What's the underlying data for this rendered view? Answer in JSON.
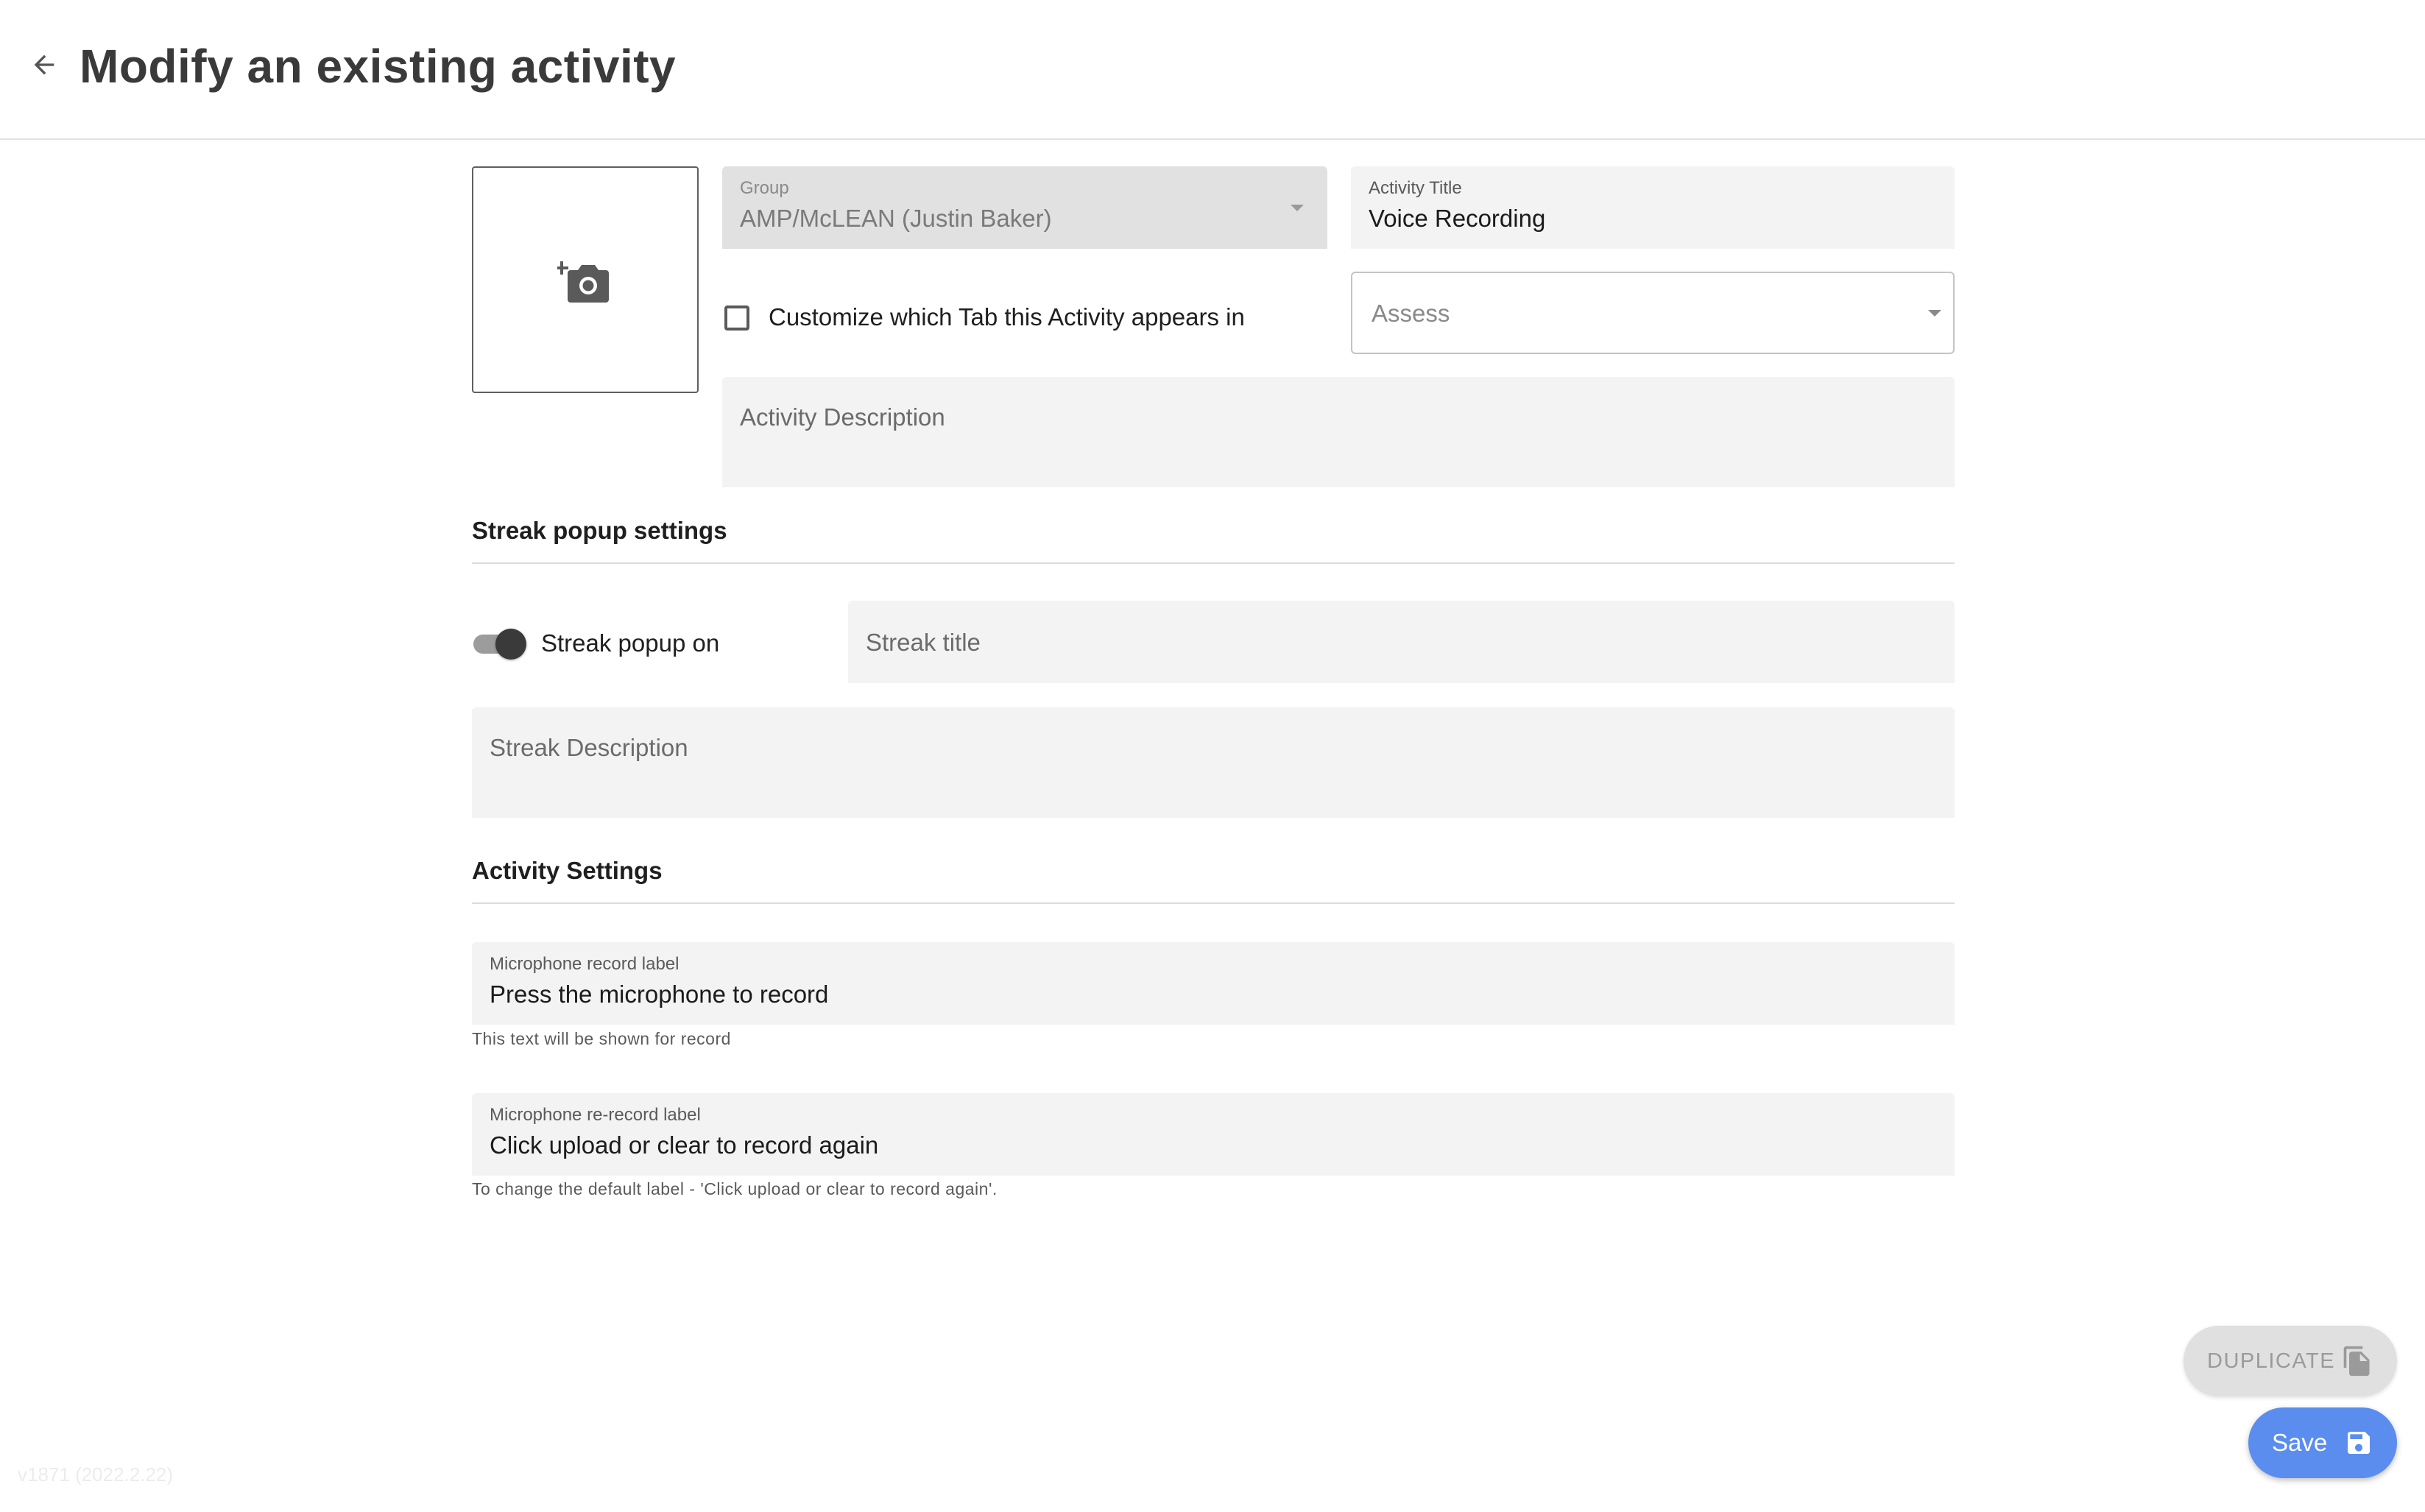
{
  "header": {
    "title": "Modify an existing activity",
    "back_icon": "arrow-left-icon"
  },
  "image_upload": {
    "icon": "add-photo-camera-icon"
  },
  "group_field": {
    "label": "Group",
    "value": "AMP/McLEAN (Justin Baker)",
    "disabled": true
  },
  "activity_title_field": {
    "label": "Activity Title",
    "value": "Voice Recording"
  },
  "customize_tab": {
    "label": "Customize which Tab this Activity appears in",
    "checked": false
  },
  "tab_select": {
    "placeholder": "Assess"
  },
  "activity_description": {
    "placeholder": "Activity Description"
  },
  "streak_section": {
    "title": "Streak popup settings",
    "toggle_label": "Streak popup on",
    "toggle_on": true,
    "streak_title_placeholder": "Streak title",
    "streak_description_placeholder": "Streak Description"
  },
  "activity_settings": {
    "title": "Activity Settings",
    "record_label": {
      "label": "Microphone record label",
      "value": "Press the microphone to record",
      "helper": "This text will be shown for record"
    },
    "rerecord_label": {
      "label": "Microphone re-record label",
      "value": "Click upload or clear to record again",
      "helper": "To change the default label - 'Click upload or clear to record again'."
    }
  },
  "buttons": {
    "duplicate_label": "DUPLICATE",
    "duplicate_icon": "file-copy-icon",
    "save_label": "Save",
    "save_icon": "floppy-disk-icon"
  },
  "footer": {
    "version": "v1871 (2022.2.22)"
  },
  "colors": {
    "accent": "#5b8def",
    "field_bg": "#f3f3f3",
    "disabled_bg": "#e1e1e1"
  }
}
